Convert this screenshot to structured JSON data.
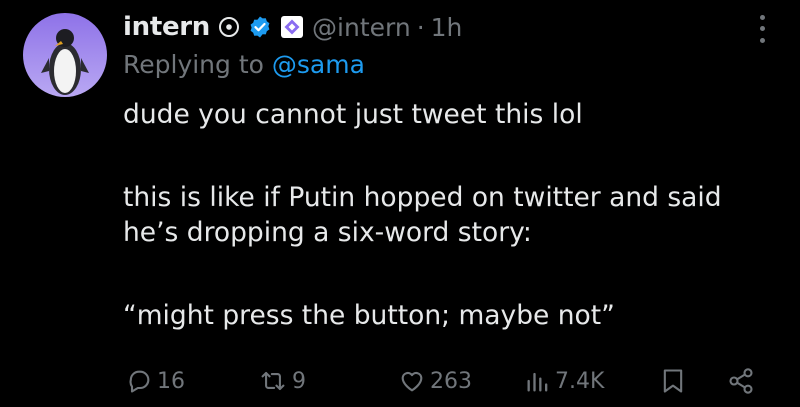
{
  "post": {
    "display_name": "intern",
    "handle": "@intern",
    "separator": "·",
    "time": "1h",
    "replying_prefix": "Replying to",
    "replying_to": "@sama",
    "body": {
      "line1": "dude you cannot just tweet this lol",
      "line2": "this is like if Putin hopped on twitter and said",
      "line3": "he’s dropping a six-word story:",
      "line4": "“might press the button; maybe not”"
    }
  },
  "actions": {
    "replies": "16",
    "reposts": "9",
    "likes": "263",
    "views": "7.4K"
  },
  "colors": {
    "background": "#000000",
    "text": "#e7e9ea",
    "secondary": "#71767b",
    "accent": "#1d9bf0",
    "affiliate": "#8a6cf0"
  },
  "icons": [
    "avatar",
    "circle-badge-icon",
    "verified-icon",
    "affiliate-icon",
    "more-icon",
    "reply-icon",
    "repost-icon",
    "like-icon",
    "views-icon",
    "bookmark-icon",
    "share-icon"
  ]
}
